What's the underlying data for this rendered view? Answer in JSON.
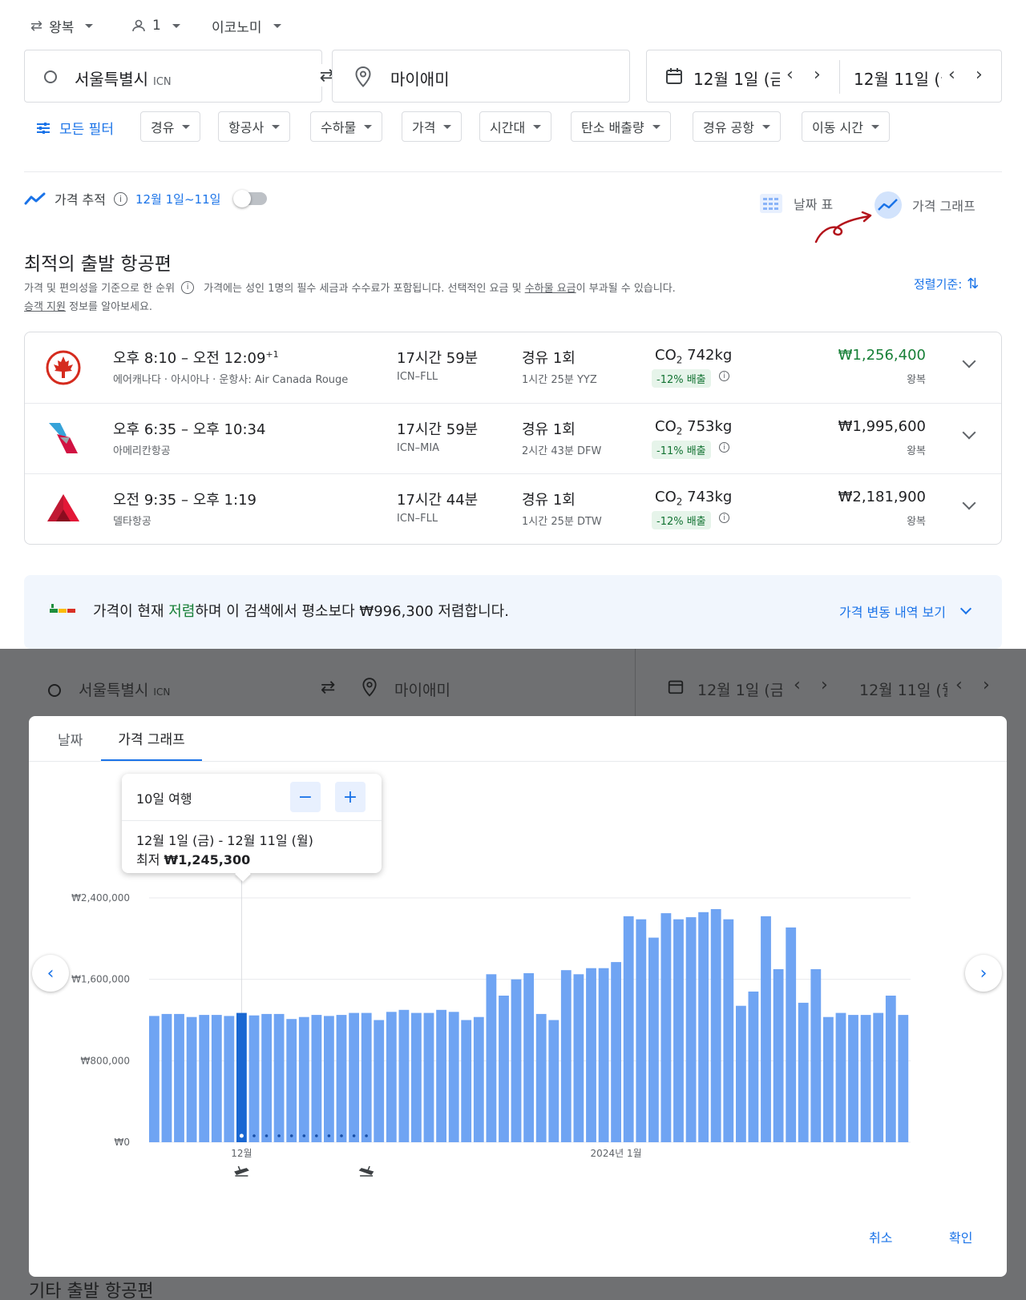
{
  "top": {
    "trip_type": "왕복",
    "passengers": "1",
    "cabin": "이코노미"
  },
  "search": {
    "origin": "서울특별시",
    "origin_code": "ICN",
    "destination": "마이애미",
    "depart_date": "12월 1일 (금)",
    "return_date": "12월 11일 (월"
  },
  "filters": {
    "all_filters": "모든 필터",
    "chips": [
      "경유",
      "항공사",
      "수하물",
      "가격",
      "시간대",
      "탄소 배출량",
      "경유 공항",
      "이동 시간"
    ]
  },
  "tracking": {
    "label": "가격 추적",
    "dates": "12월 1일~11일",
    "date_table": "날짜 표",
    "price_graph": "가격 그래프"
  },
  "results": {
    "title": "최적의 출발 항공편",
    "subtitle_1": "가격 및 편의성을 기준으로 한 순위",
    "subtitle_2": "가격에는 성인 1명의 필수 세금과 수수료가 포함됩니다. 선택적인 요금 및",
    "baggage_link": "수하물 요금",
    "subtitle_3": "이 부과될 수 있습니다.",
    "assist_link": "승객 지원",
    "assist_tail": "정보를 알아보세요.",
    "sort_label": "정렬기준:"
  },
  "flights": [
    {
      "times": "오후 8:10 – 오전 12:09",
      "plus_day": "+1",
      "airline": "에어캐나다 · 아시아나 · 운항사: Air Canada Rouge",
      "duration": "17시간 59분",
      "route": "ICN–FLL",
      "stops": "경유 1회",
      "layover": "1시간 25분 YYZ",
      "co2_prefix": "CO",
      "co2_sub": "2",
      "co2": "742kg",
      "emission": "-12% 배출",
      "price": "₩1,256,400",
      "price_type": "왕복",
      "logo": "maple-leaf",
      "price_color": "#188038"
    },
    {
      "times": "오후 6:35 – 오후 10:34",
      "plus_day": "",
      "airline": "아메리칸항공",
      "duration": "17시간 59분",
      "route": "ICN–MIA",
      "stops": "경유 1회",
      "layover": "2시간 43분 DFW",
      "co2_prefix": "CO",
      "co2_sub": "2",
      "co2": "753kg",
      "emission": "-11% 배출",
      "price": "₩1,995,600",
      "price_type": "왕복",
      "logo": "american-flight-symbol",
      "price_color": "#202124"
    },
    {
      "times": "오전 9:35 – 오후 1:19",
      "plus_day": "",
      "airline": "델타항공",
      "duration": "17시간 44분",
      "route": "ICN–FLL",
      "stops": "경유 1회",
      "layover": "1시간 25분 DTW",
      "co2_prefix": "CO",
      "co2_sub": "2",
      "co2": "743kg",
      "emission": "-12% 배출",
      "price": "₩2,181,900",
      "price_type": "왕복",
      "logo": "delta-widget",
      "price_color": "#202124"
    }
  ],
  "insight": {
    "pre": "가격이 현재",
    "highlight": "저렴",
    "post": "하며 이 검색에서 평소보다 ₩996,300 저렴합니다.",
    "history_link": "가격 변동 내역 보기"
  },
  "modal": {
    "tab_dates": "날짜",
    "tab_graph": "가격 그래프",
    "trip_length": "10일 여행",
    "range": "12월 1일 (금) - 12월 11일 (월)",
    "lowest_label": "최저",
    "lowest_price": "₩1,245,300",
    "cancel": "취소",
    "confirm": "확인",
    "behind_text": "기타 출발 항공편"
  },
  "chart_data": {
    "type": "bar",
    "title": "",
    "xlabel": "",
    "ylabel": "",
    "ylim": [
      0,
      2400000
    ],
    "y_ticks": [
      "₩0",
      "₩800,000",
      "₩1,600,000",
      "₩2,400,000"
    ],
    "x_tick_labels": [
      {
        "index": 7,
        "label": "12월"
      },
      {
        "index": 37,
        "label": "2024년 1월"
      }
    ],
    "selected_index": 7,
    "trip_end_index": 17,
    "values": [
      1240000,
      1260000,
      1260000,
      1230000,
      1250000,
      1250000,
      1240000,
      1270000,
      1245300,
      1260000,
      1260000,
      1210000,
      1230000,
      1250000,
      1240000,
      1250000,
      1270000,
      1270000,
      1200000,
      1280000,
      1300000,
      1270000,
      1270000,
      1300000,
      1280000,
      1200000,
      1230000,
      1650000,
      1440000,
      1600000,
      1660000,
      1260000,
      1200000,
      1690000,
      1650000,
      1710000,
      1710000,
      1770000,
      2220000,
      2190000,
      2010000,
      2250000,
      2190000,
      2210000,
      2260000,
      2290000,
      2190000,
      1340000,
      1480000,
      2220000,
      1700000,
      2110000,
      1370000,
      1700000,
      1230000,
      1270000,
      1250000,
      1250000,
      1270000,
      1440000,
      1250000
    ]
  }
}
